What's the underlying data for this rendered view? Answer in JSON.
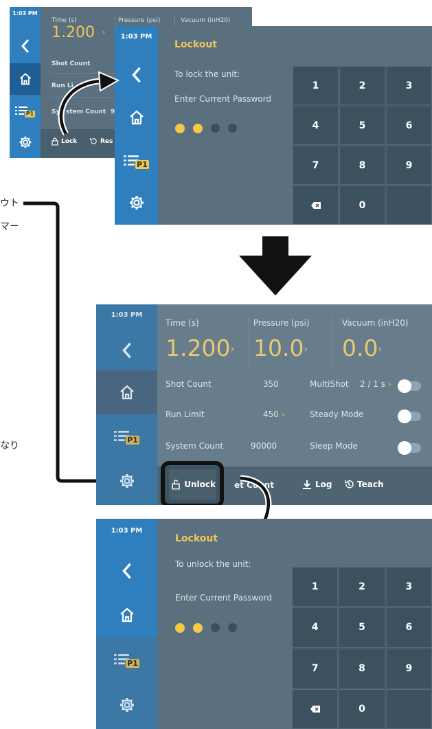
{
  "clock": "1:03 PM",
  "badge": "P1",
  "icons": [
    "back-chevron-icon",
    "home-icon",
    "program-list-icon",
    "settings-gear-icon",
    "lock-icon",
    "unlock-icon",
    "reset-icon",
    "log-download-icon",
    "teach-history-icon",
    "backspace-icon"
  ],
  "colors": {
    "sidebar": "#2f7fbe",
    "content": "#5b707e",
    "accent": "#f2c45a",
    "keypad": "#3c5160",
    "arrow": "#000000"
  },
  "panel1": {
    "time_label": "Time (s)",
    "time_value": "1.200",
    "pressure_label": "Pressure (psi)",
    "vacuum_label": "Vacuum (inH20)",
    "shot_count": "Shot Count",
    "run_limit": "Run Li",
    "system_count_a": "Sy",
    "system_count_b": "stem Count",
    "system_count_c": "9",
    "lock": "Lock",
    "reset": "Res"
  },
  "panel2": {
    "title": "Lockout",
    "line1": "To lock the unit:",
    "line2": "Enter Current Password",
    "keys": [
      "1",
      "2",
      "3",
      "4",
      "5",
      "6",
      "7",
      "8",
      "9",
      "⌫",
      "0",
      ""
    ]
  },
  "panel3": {
    "time_label": "Time (s)",
    "time_value": "1.200",
    "pressure_label": "Pressure (psi)",
    "pressure_value": "10.0",
    "vacuum_label": "Vacuum (inH20)",
    "vacuum_value": "0.0",
    "shot_count_label": "Shot Count",
    "shot_count_value": "350",
    "multishot_label": "MultiShot",
    "multishot_value": "2 / 1 s",
    "run_limit_label": "Run Limit",
    "run_limit_value": "450",
    "steady_mode": "Steady Mode",
    "system_count_label": "System Count",
    "system_count_value": "90000",
    "sleep_mode": "Sleep Mode",
    "unlock": "Unlock",
    "reset_count": "et Count",
    "log": "Log",
    "teach": "Teach",
    "chevron": "›"
  },
  "panel4": {
    "title": "Lockout",
    "line1": "To unlock the unit:",
    "line2": "Enter Current Password",
    "keys": [
      "1",
      "2",
      "3",
      "4",
      "5",
      "6",
      "7",
      "8",
      "9",
      "⌫",
      "0",
      ""
    ]
  },
  "japanese": {
    "a": "ウト",
    "b": "マー",
    "c": "なり"
  }
}
